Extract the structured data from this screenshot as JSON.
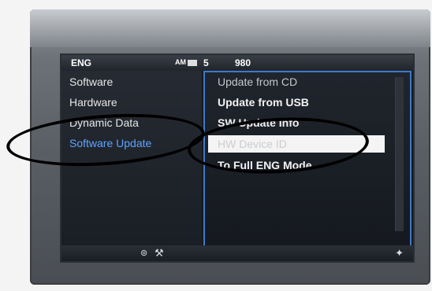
{
  "status_bar": {
    "language": "ENG",
    "band": "AM",
    "preset": "5",
    "frequency": "980"
  },
  "left_menu": {
    "items": [
      {
        "label": "Software"
      },
      {
        "label": "Hardware"
      },
      {
        "label": "Dynamic Data"
      },
      {
        "label": "Software Update",
        "active": true
      }
    ]
  },
  "right_menu": {
    "items": [
      {
        "label": "Update from CD"
      },
      {
        "label": "Update from USB"
      },
      {
        "label": "SW Update Info"
      },
      {
        "label": "HW Device ID",
        "selected": true
      },
      {
        "label": "To Full ENG Mode"
      }
    ]
  },
  "bottom_bar": {
    "icons": [
      "bluetooth-icon",
      "tool-icon",
      "navigation-icon"
    ]
  },
  "colors": {
    "active_text": "#5fa3ff",
    "panel_border": "#3f78c8",
    "annotation": "#000000"
  }
}
